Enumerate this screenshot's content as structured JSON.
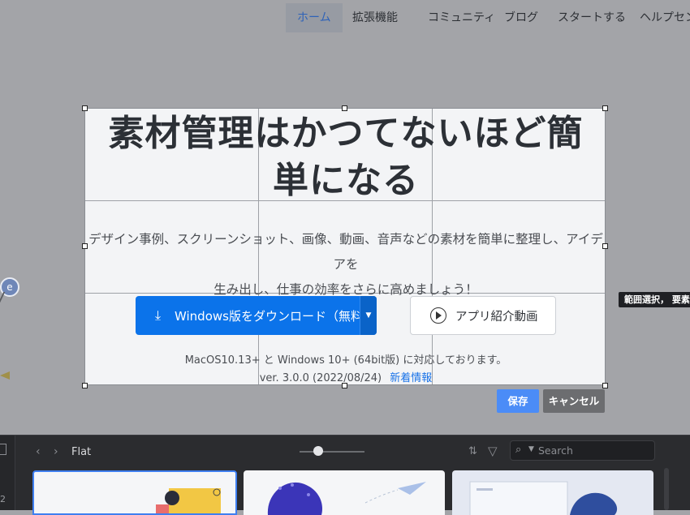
{
  "nav": {
    "items": [
      "ホーム",
      "拡張機能",
      "コミュニティ",
      "ブログ",
      "スタートする",
      "ヘルプセン"
    ]
  },
  "hero": {
    "title_line1": "素材管理はかつてないほど簡",
    "title_line2": "単になる",
    "subtitle_line1": "デザイン事例、スクリーンショット、画像、動画、音声などの素材を簡単に整理し、アイデアを",
    "subtitle_line2": "生み出し、仕事の効率をさらに高めましょう！",
    "download_label": "Windows版をダウンロード（無料）",
    "video_label": "アプリ紹介動画",
    "support_text": "MacOS10.13+ と Windows 10+ (64bit版) に対応しております。",
    "version_text": "ver. 3.0.0 (2022/08/24)",
    "news_link": "新着情報"
  },
  "capture": {
    "save_label": "保存",
    "cancel_label": "キャンセル",
    "tooltip": "範囲選択， 要素"
  },
  "app": {
    "folder_name": "Flat",
    "search_placeholder": "Search",
    "left_number": "2"
  },
  "colors": {
    "accent": "#0b73ea",
    "save": "#4b8cf7",
    "cancel": "#6c6d70",
    "overlay": "#a3a4a8",
    "panel": "#2b2c2f"
  }
}
